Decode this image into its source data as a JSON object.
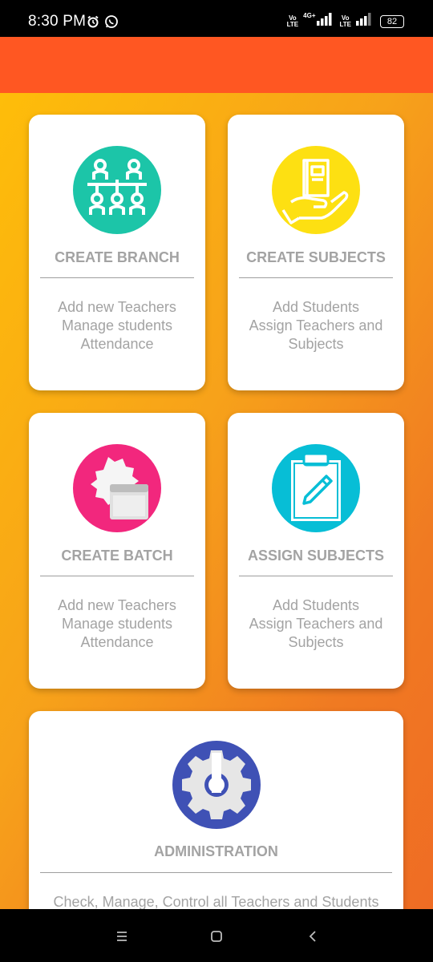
{
  "status_bar": {
    "time": "8:30 PM",
    "net1_label_a": "Vo",
    "net1_label_b": "LTE",
    "net2_label_a": "4G+",
    "net3_label_a": "Vo",
    "net3_label_b": "LTE",
    "battery": "82",
    "icons": [
      "alarm-icon",
      "whatsapp-icon",
      "signal-icon",
      "battery-icon"
    ]
  },
  "colors": {
    "app_bar": "#ff5722",
    "branch_icon_bg": "#1cc5a8",
    "subjects_icon_bg": "#fde012",
    "batch_icon_bg": "#f2277d",
    "assign_icon_bg": "#07bed6",
    "admin_icon_bg": "#3f51b5"
  },
  "cards": [
    {
      "title": "CREATE BRANCH",
      "desc": "Add new Teachers\nManage students\nAttendance",
      "icon": "people-hierarchy-icon"
    },
    {
      "title": "CREATE SUBJECTS",
      "desc": "Add Students\nAssign Teachers and\nSubjects",
      "icon": "book-in-hand-icon"
    },
    {
      "title": "CREATE BATCH",
      "desc": "Add new Teachers\nManage students\nAttendance",
      "icon": "badge-window-icon"
    },
    {
      "title": "ASSIGN SUBJECTS",
      "desc": "Add Students\nAssign Teachers and\nSubjects",
      "icon": "clipboard-pencil-icon"
    },
    {
      "title": "ADMINISTRATION",
      "desc": "Check, Manage, Control all Teachers and Students",
      "icon": "gear-icon"
    }
  ],
  "nav": [
    "recent-apps-icon",
    "home-icon",
    "back-icon"
  ]
}
